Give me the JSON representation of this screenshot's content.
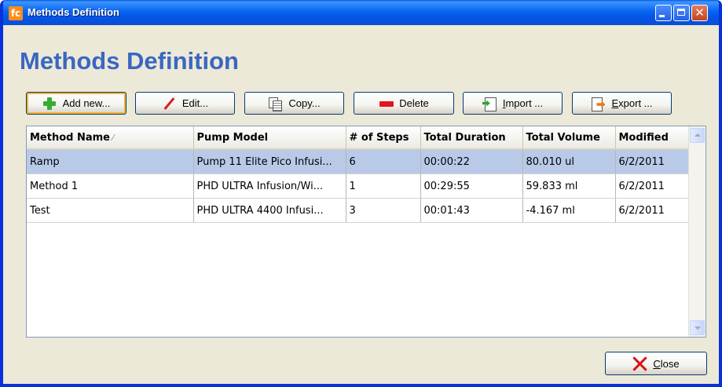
{
  "window": {
    "title": "Methods Definition",
    "app_icon_text": "fc"
  },
  "heading": "Methods Definition",
  "toolbar": {
    "add_label": "Add new...",
    "edit_label": "Edit...",
    "copy_label": "Copy...",
    "delete_label": "Delete",
    "import_prefix": "I",
    "import_rest": "mport ...",
    "export_prefix": "E",
    "export_rest": "xport ..."
  },
  "table": {
    "columns": [
      "Method Name",
      "Pump Model",
      "# of Steps",
      "Total Duration",
      "Total Volume",
      "Modified"
    ],
    "sort_indicator": "⁄",
    "rows": [
      {
        "name": "Ramp",
        "pump": "Pump 11 Elite Pico Infusi...",
        "steps": "6",
        "duration": "00:00:22",
        "volume": "80.010 ul",
        "modified": "6/2/2011"
      },
      {
        "name": "Method 1",
        "pump": "PHD ULTRA Infusion/Wi...",
        "steps": "1",
        "duration": "00:29:55",
        "volume": "59.833 ml",
        "modified": "6/2/2011"
      },
      {
        "name": "Test",
        "pump": "PHD ULTRA 4400 Infusi...",
        "steps": "3",
        "duration": "00:01:43",
        "volume": "-4.167 ml",
        "modified": "6/2/2011"
      }
    ]
  },
  "close_button": {
    "prefix": "C",
    "rest": "lose"
  }
}
